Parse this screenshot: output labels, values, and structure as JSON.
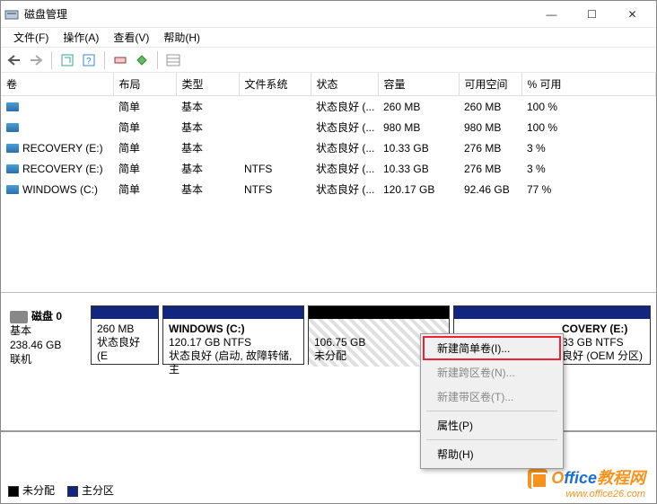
{
  "window": {
    "title": "磁盘管理",
    "buttons": {
      "min": "—",
      "max": "☐",
      "close": "✕"
    }
  },
  "menu": {
    "file": "文件(F)",
    "action": "操作(A)",
    "view": "查看(V)",
    "help": "帮助(H)"
  },
  "columns": {
    "volume": "卷",
    "layout": "布局",
    "type": "类型",
    "fs": "文件系统",
    "status": "状态",
    "capacity": "容量",
    "free": "可用空间",
    "pctfree": "% 可用"
  },
  "rows": [
    {
      "name": "",
      "layout": "简单",
      "type": "基本",
      "fs": "",
      "status": "状态良好 (...",
      "capacity": "260 MB",
      "free": "260 MB",
      "pct": "100 %"
    },
    {
      "name": "",
      "layout": "简单",
      "type": "基本",
      "fs": "",
      "status": "状态良好 (...",
      "capacity": "980 MB",
      "free": "980 MB",
      "pct": "100 %"
    },
    {
      "name": "RECOVERY (E:)",
      "layout": "简单",
      "type": "基本",
      "fs": "",
      "status": "状态良好 (...",
      "capacity": "10.33 GB",
      "free": "276 MB",
      "pct": "3 %"
    },
    {
      "name": "RECOVERY (E:)",
      "layout": "简单",
      "type": "基本",
      "fs": "NTFS",
      "status": "状态良好 (...",
      "capacity": "10.33 GB",
      "free": "276 MB",
      "pct": "3 %"
    },
    {
      "name": "WINDOWS (C:)",
      "layout": "简单",
      "type": "基本",
      "fs": "NTFS",
      "status": "状态良好 (...",
      "capacity": "120.17 GB",
      "free": "92.46 GB",
      "pct": "77 %"
    }
  ],
  "disk": {
    "name": "磁盘 0",
    "type": "基本",
    "size": "238.46 GB",
    "status": "联机"
  },
  "parts": [
    {
      "title": "",
      "line1": "260 MB",
      "line2": "状态良好 (E"
    },
    {
      "title": "WINDOWS  (C:)",
      "line1": "120.17 GB NTFS",
      "line2": "状态良好 (启动, 故障转储, 主"
    },
    {
      "title": "",
      "line1": "106.75 GB",
      "line2": "未分配"
    },
    {
      "title": "COVERY  (E:)",
      "line1": "33 GB NTFS",
      "line2": "良好 (OEM 分区)"
    }
  ],
  "context": {
    "new_simple": "新建简单卷(I)...",
    "new_span": "新建跨区卷(N)...",
    "new_stripe": "新建带区卷(T)...",
    "properties": "属性(P)",
    "help": "帮助(H)"
  },
  "legend": {
    "unallocated": "未分配",
    "primary": "主分区"
  },
  "watermark": {
    "brand": "Office教程网",
    "url": "www.office26.com"
  }
}
